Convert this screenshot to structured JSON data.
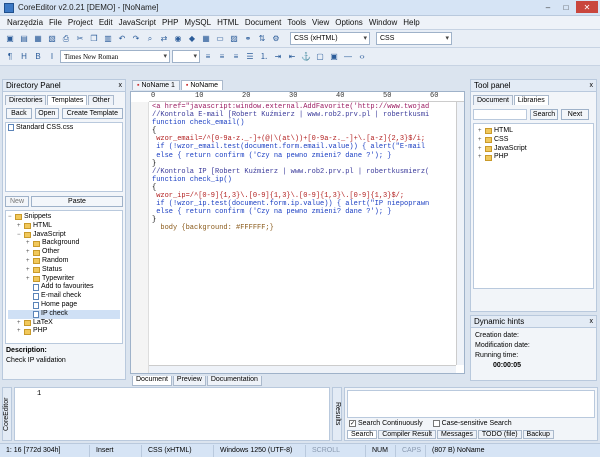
{
  "window": {
    "title": "CoreEditor v2.0.21 [DEMO] - [NoName]",
    "min": "–",
    "max": "□",
    "close": "✕"
  },
  "menu": [
    "Narzędzia",
    "File",
    "Project",
    "Edit",
    "JavaScript",
    "PHP",
    "MySQL",
    "HTML",
    "Document",
    "Tools",
    "View",
    "Options",
    "Window",
    "Help"
  ],
  "toolbar1": {
    "doctype": "CSS (xHTML)",
    "lang": "CSS"
  },
  "toolbar2": {
    "font": "Times New Roman"
  },
  "left_panel": {
    "title": "Directory Panel",
    "close": "x",
    "tabs": [
      "Directories",
      "Templates",
      "Other"
    ],
    "buttons": {
      "back": "Back",
      "open": "Open",
      "create": "Create Template"
    },
    "files": [
      "Standard CSS.css"
    ],
    "new_btn": "New",
    "paste_btn": "Paste",
    "tree": [
      {
        "label": "Snippets",
        "level": 0,
        "exp": "−",
        "type": "folder"
      },
      {
        "label": "HTML",
        "level": 1,
        "exp": "+",
        "type": "folder"
      },
      {
        "label": "JavaScript",
        "level": 1,
        "exp": "−",
        "type": "folder"
      },
      {
        "label": "Background",
        "level": 2,
        "exp": "+",
        "type": "folder"
      },
      {
        "label": "Other",
        "level": 2,
        "exp": "+",
        "type": "folder"
      },
      {
        "label": "Random",
        "level": 2,
        "exp": "+",
        "type": "folder"
      },
      {
        "label": "Status",
        "level": 2,
        "exp": "+",
        "type": "folder"
      },
      {
        "label": "Typewriter",
        "level": 2,
        "exp": "+",
        "type": "folder"
      },
      {
        "label": "Add to favourites",
        "level": 2,
        "exp": "",
        "type": "file"
      },
      {
        "label": "E-mail check",
        "level": 2,
        "exp": "",
        "type": "file"
      },
      {
        "label": "Home page",
        "level": 2,
        "exp": "",
        "type": "file"
      },
      {
        "label": "IP check",
        "level": 2,
        "exp": "",
        "type": "file"
      },
      {
        "label": "LaTeX",
        "level": 1,
        "exp": "+",
        "type": "folder"
      },
      {
        "label": "PHP",
        "level": 1,
        "exp": "+",
        "type": "folder"
      }
    ],
    "description_label": "Description:",
    "description_text": "Check IP validation"
  },
  "editor": {
    "tabs": [
      "NoName 1",
      "NoName"
    ],
    "ruler": [
      "0",
      "10",
      "20",
      "30",
      "40",
      "50",
      "60"
    ],
    "lines": [
      {
        "cls": "c-tag",
        "text": "<a href=\"javascript:window.external.AddFavorite('http://www.twojad"
      },
      {
        "cls": "c-cm",
        "text": "//Kontrola E-mail [Robert Kuźmierz | www.rob2.prv.pl | robertkusmi"
      },
      {
        "cls": "c-kw",
        "text": "function check_email()"
      },
      {
        "cls": "",
        "text": "{"
      },
      {
        "cls": "c-str",
        "text": " wzor_email=/^[0-9a-z._-]+(@|\\(at\\))+[0-9a-z._-]+\\.[a-z]{2,3}$/i;"
      },
      {
        "cls": "c-kw",
        "text": " if (!wzor_email.test(document.form.email.value)) { alert(\"E-mail"
      },
      {
        "cls": "c-kw",
        "text": " else { return confirm ('Czy na pewno zmieni? dane ?'); }"
      },
      {
        "cls": "",
        "text": "}"
      },
      {
        "cls": "c-cm",
        "text": "//Kontrola IP [Robert Kuźmierz | www.rob2.prv.pl | robertkusmierz("
      },
      {
        "cls": "c-kw",
        "text": "function check_ip()"
      },
      {
        "cls": "",
        "text": "{"
      },
      {
        "cls": "c-str",
        "text": " wzor_ip=/^[0-9]{1,3}\\.[0-9]{1,3}\\.[0-9]{1,3}\\.[0-9]{1,3}$/;"
      },
      {
        "cls": "c-kw",
        "text": " if (!wzor_ip.test(document.form.ip.value)) { alert(\"IP niepoprawn"
      },
      {
        "cls": "c-kw",
        "text": " else { return confirm ('Czy na pewno zmieni? dane ?'); }"
      },
      {
        "cls": "",
        "text": "}"
      },
      {
        "cls": "c-css",
        "text": "  body {background: #FFFFFF;}"
      }
    ],
    "bottom_tabs": [
      "Document",
      "Preview",
      "Documentation"
    ]
  },
  "right_panel": {
    "title": "Tool panel",
    "close": "x",
    "tabs": [
      "Document",
      "Libraries"
    ],
    "search_btn": "Search",
    "next_btn": "Next",
    "tree": [
      "HTML",
      "CSS",
      "JavaScript",
      "PHP"
    ]
  },
  "hints": {
    "title": "Dynamic hints",
    "creation": "Creation date:",
    "modification": "Modification date:",
    "running": "Running time:",
    "time": "00:00:05"
  },
  "output": {
    "side_label": "CoreEditor",
    "line_no": "1",
    "results_label": "Results",
    "search_cont": "Search Continuously",
    "case_sens": "Case-sensitive Search",
    "tabs": [
      "Search",
      "Compiler Result",
      "Messages",
      "TODO (file)",
      "Backup"
    ]
  },
  "status": [
    "1: 16 [772d 304h]",
    "Insert",
    "CSS (xHTML)",
    "Windows 1250 (UTF-8)",
    "SCROLL",
    "NUM",
    "CAPS",
    "(807 B) NoName"
  ]
}
